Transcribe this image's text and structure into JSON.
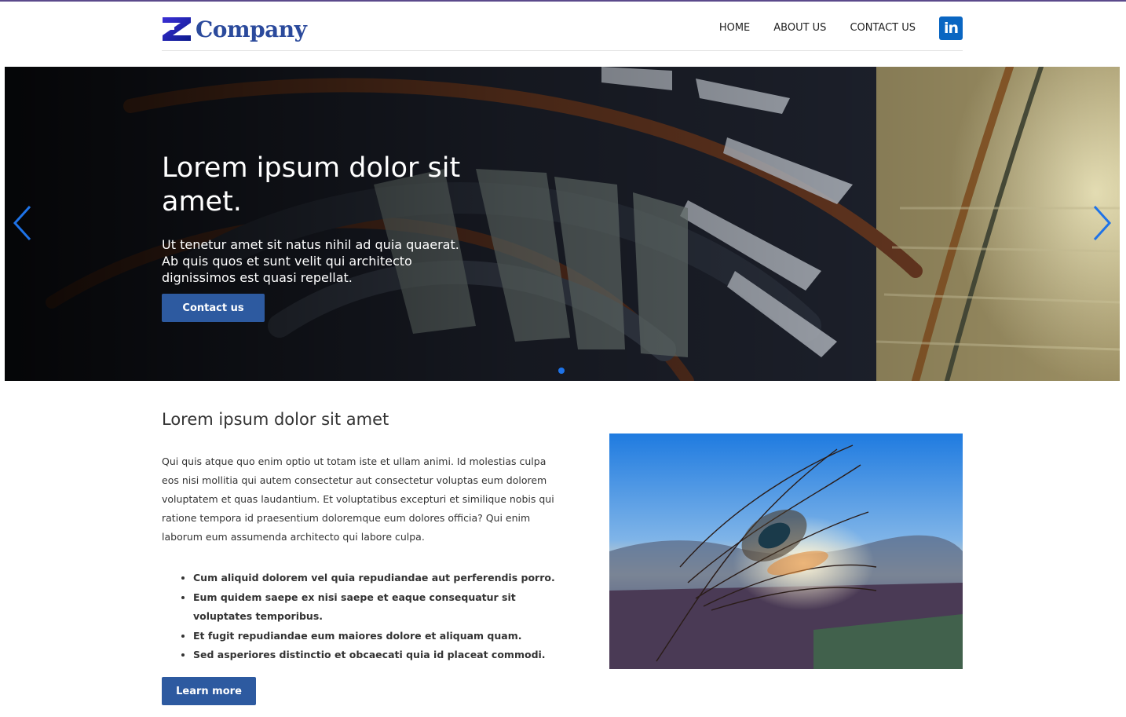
{
  "header": {
    "logo_text": "Company",
    "nav": [
      {
        "label": "HOME"
      },
      {
        "label": "ABOUT US"
      },
      {
        "label": "CONTACT US"
      }
    ],
    "social_icon": "linkedin-icon",
    "social_glyph": "in"
  },
  "hero": {
    "title": "Lorem ipsum dolor sit amet.",
    "text": "Ut tenetur amet sit natus nihil ad quia quaerat. Ab quis quos et sunt velit qui architecto dignissimos est quasi repellat.",
    "button_label": "Contact us",
    "prev_icon": "chevron-left-icon",
    "next_icon": "chevron-right-icon",
    "active_slide": 1,
    "slide_count": 1
  },
  "main": {
    "heading": "Lorem ipsum dolor sit amet",
    "paragraph": "Qui quis atque quo enim optio ut totam iste et ullam animi. Id molestias culpa eos nisi mollitia qui autem consectetur aut consectetur voluptas eum dolorem voluptatem et quas laudantium. Et voluptatibus excepturi et similique nobis qui ratione tempora id praesentium doloremque eum dolores officia? Qui enim laborum eum assumenda architecto qui labore culpa.",
    "bullets": [
      "Cum aliquid dolorem vel quia repudiandae aut perferendis porro.",
      "Eum quidem saepe ex nisi saepe et eaque consequatur sit voluptates temporibus.",
      "Et fugit repudiandae eum maiores dolore et aliquam quam.",
      "Sed asperiores distinctio et obcaecati quia id placeat commodi."
    ],
    "button_label": "Learn more"
  },
  "colors": {
    "brand": "#2b4a9c",
    "button": "#2d5aa0",
    "carousel_accent": "#1e73e8",
    "linkedin": "#0a66c2"
  }
}
